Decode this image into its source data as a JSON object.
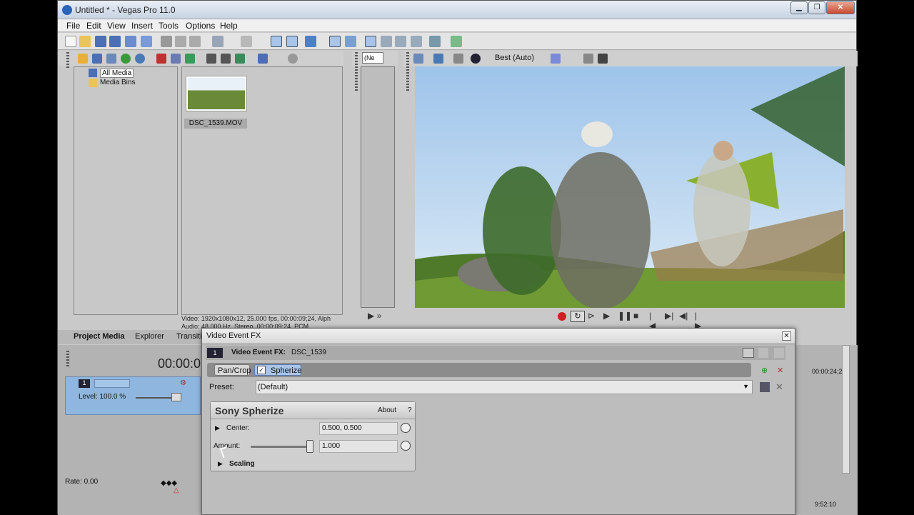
{
  "window": {
    "title": "Untitled * - Vegas Pro 11.0",
    "controls": [
      "▁",
      "❐",
      "✕"
    ]
  },
  "menu": [
    "File",
    "Edit",
    "View",
    "Insert",
    "Tools",
    "Options",
    "Help"
  ],
  "tree": {
    "items": [
      "All Media",
      "Media Bins"
    ]
  },
  "media": {
    "file": "DSC_1539.MOV",
    "info_line1": "Video: 1920x1080x12, 25.000 fps, 00:00:09;24, Alph",
    "info_line2": "Audio: 48,000 Hz, Stereo, 00:00:09;24, PCM"
  },
  "tabs": [
    "Project Media",
    "Explorer",
    "Transiti"
  ],
  "preview": {
    "quality": "Best (Auto)",
    "dropdown": "(Ne"
  },
  "timeline": {
    "time": "00:00:0",
    "track_number": "1",
    "level": "Level: 100.0 %",
    "rate": "Rate: 0.00",
    "ruler_time": "00:00:24;2",
    "bottom_time": "9:52:10"
  },
  "fx": {
    "window_title": "Video Event FX",
    "header_label": "Video Event FX:",
    "header_name": "DSC_1539",
    "track_number": "1",
    "chain": [
      "Pan/Crop",
      "Spherize"
    ],
    "preset_label": "Preset:",
    "preset_value": "(Default)",
    "plugin": {
      "title": "Sony Spherize",
      "about": "About",
      "help": "?",
      "center_label": "Center:",
      "center_value": "0.500, 0.500",
      "amount_label": "Amount:",
      "amount_value": "1.000",
      "amount_fraction": 1.0,
      "scaling_label": "Scaling"
    }
  },
  "colors": {
    "accent": "#2a64b8",
    "track": "#8fb6de",
    "record": "#cc2222"
  }
}
